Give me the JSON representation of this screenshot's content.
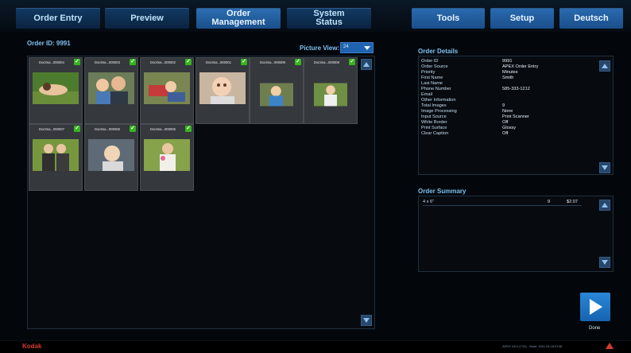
{
  "nav": {
    "tabs": [
      {
        "label": "Order Entry"
      },
      {
        "label": "Preview"
      },
      {
        "label_line1": "Order",
        "label_line2": "Management"
      },
      {
        "label_line1": "System",
        "label_line2": "Status"
      }
    ],
    "right_tabs": [
      {
        "label": "Tools"
      },
      {
        "label": "Setup"
      },
      {
        "label": "Deutsch"
      }
    ]
  },
  "order": {
    "id_label": "Order ID: 9991",
    "picture_view_label": "Picture View:",
    "picture_view_value": "24"
  },
  "thumbnails": [
    {
      "name": "DocIma...000004"
    },
    {
      "name": "DocIma...000003"
    },
    {
      "name": "DocIma...000002"
    },
    {
      "name": "DocIma...000001"
    },
    {
      "name": "DocIma...000009"
    },
    {
      "name": "DocIma...000008"
    },
    {
      "name": "DocIma...000007"
    },
    {
      "name": "DocIma...000006"
    },
    {
      "name": "DocIma...000005"
    }
  ],
  "details": {
    "title": "Order Details",
    "rows": [
      {
        "label": "Order ID",
        "value": "9991"
      },
      {
        "label": "Order Source",
        "value": "APEX Order Entry"
      },
      {
        "label": "Priority",
        "value": "Minutes"
      },
      {
        "label": "First Name",
        "value": "Smith"
      },
      {
        "label": "Last Name",
        "value": ""
      },
      {
        "label": "Phone Number",
        "value": "585-333-1212"
      },
      {
        "label": "Email",
        "value": ""
      },
      {
        "label": "Other Information",
        "value": ""
      },
      {
        "label": "Total Images",
        "value": "9"
      },
      {
        "label": "Image Processing",
        "value": "None"
      },
      {
        "label": "Input Source",
        "value": "Print Scanner"
      },
      {
        "label": "White Border",
        "value": "Off"
      },
      {
        "label": "Print Surface",
        "value": "Glossy"
      },
      {
        "label": "Clear Caption",
        "value": "Off"
      }
    ]
  },
  "summary": {
    "title": "Order Summary",
    "rows": [
      {
        "size": "4 x 6\"",
        "qty": "9",
        "price": "$2.07"
      }
    ]
  },
  "done": {
    "label": "Done"
  },
  "footer": {
    "brand": "Kodak",
    "version": "APEX V8.0 (T10) - Build: 2011.03.18.0746"
  }
}
